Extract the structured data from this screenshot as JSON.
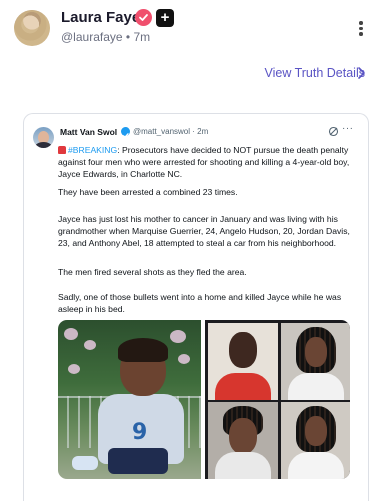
{
  "post": {
    "author_name": "Laura Faye",
    "handle": "@laurafaye",
    "separator": "•",
    "time": "7m",
    "plus_icon": "+",
    "view_link": "View Truth Details"
  },
  "quoted": {
    "author_name": "Matt Van Swol",
    "handle": "@matt_vanswol",
    "separator": "·",
    "time": "2m",
    "more": "···",
    "hashtag": "#BREAKING",
    "text_after_hashtag": ": Prosecutors have decided to NOT pursue the death penalty against four men who were arrested for shooting and killing a 4-year-old boy, Jayce Edwards, in Charlotte NC.",
    "para2": "They have been arrested a combined 23 times.",
    "para3": "Jayce has just lost his mother to cancer in January and was living with his grandmother when Marquise Guerrier, 24, Angelo Hudson, 20, Jordan Davis, 23, and Anthony Abel, 18 attempted to steal a car from his neighborhood.",
    "para4": "The men fired several shots as they fled the area.",
    "para5": "Sadly, one of those bullets went into a home and killed Jayce while he was asleep in his bed."
  },
  "icons": [
    "avatar",
    "verified-badge-icon",
    "plus-icon",
    "more-vertical-icon",
    "chevron-right-icon",
    "siren-icon",
    "grok-icon",
    "more-horizontal-icon"
  ],
  "colors": {
    "accent_link": "#5a54c4",
    "verified_pink": "#f04f6d",
    "verified_blue": "#1d9bf0",
    "hashtag": "#1d9bf0"
  }
}
